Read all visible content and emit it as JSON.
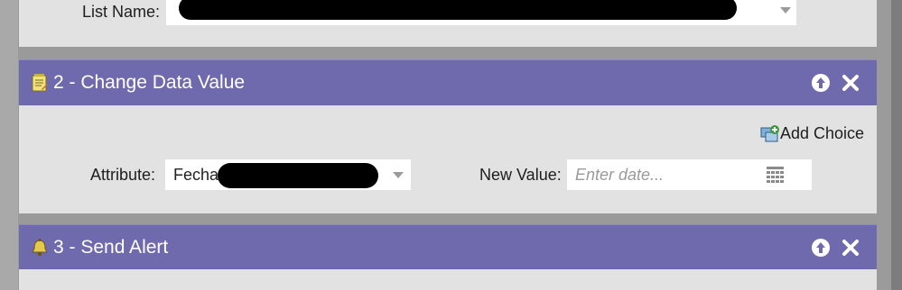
{
  "step1": {
    "list_name_label": "List Name:",
    "list_name_value": ""
  },
  "step2": {
    "title": "2 - Change Data Value",
    "add_choice_label": "Add Choice",
    "attribute_label": "Attribute:",
    "attribute_value": "Fecha",
    "new_value_label": "New Value:",
    "new_value_placeholder": "Enter date..."
  },
  "step3": {
    "title": "3 - Send Alert"
  },
  "icons": {
    "step2": "notepad-icon",
    "step3": "bell-icon",
    "move_up": "arrow-up-circle-icon",
    "remove": "close-icon",
    "add_choice": "add-choice-icon",
    "calendar": "calendar-icon",
    "dropdown": "chevron-down-icon"
  },
  "colors": {
    "header_bg": "#6f6aae",
    "panel_bg": "#e2e2e2",
    "page_bg": "#9a9a9a"
  }
}
